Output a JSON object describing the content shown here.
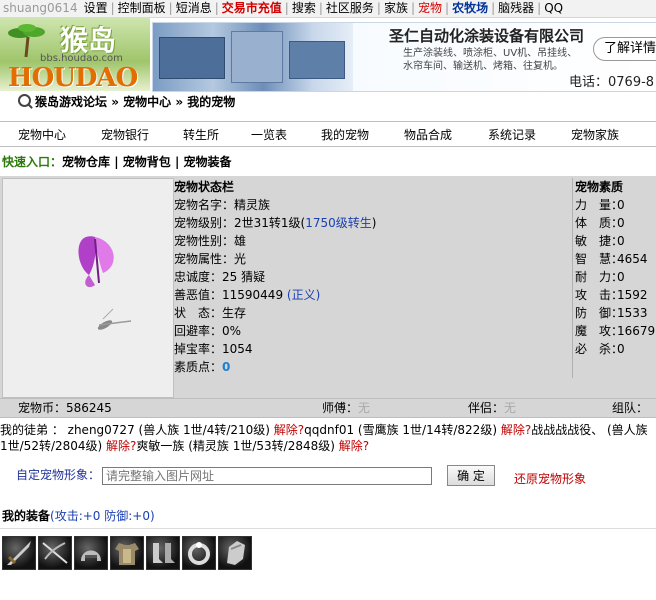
{
  "topnav": {
    "user": "shuang0614",
    "items": [
      "设置",
      "控制面板",
      "短消息",
      "交易市充值",
      "搜索",
      "社区服务",
      "家族",
      "宠物",
      "农牧场",
      "脑残器",
      "QQ"
    ],
    "special": {
      "trade": "交易市充值",
      "pet": "宠物",
      "farm": "农牧场"
    }
  },
  "logo": {
    "text": "HOUDAO",
    "cn": "猴岛",
    "bbs": "bbs.houdao.com"
  },
  "banner": {
    "company": "圣仁自动化涂装设备有限公司",
    "desc": "生产涂装线、喷涂柜、UV机、吊挂线、水帘车间、输送机、烤箱、往复机。",
    "phone": "电话：0769-8",
    "button": "了解详情"
  },
  "breadcrumb": [
    "猴岛游戏论坛",
    "宠物中心",
    "我的宠物"
  ],
  "tabs": [
    "宠物中心",
    "宠物银行",
    "转生所",
    "一览表",
    "我的宠物",
    "物品合成",
    "系统记录",
    "宠物家族"
  ],
  "quick": {
    "label": "快速入口：",
    "links": [
      "宠物仓库",
      "宠物背包",
      "宠物装备"
    ]
  },
  "pet": {
    "title": "宠物状态栏",
    "name": "宠物名字：精灵族",
    "level_prefix": "宠物级别：2世31转1级(",
    "level_link": "1750级转生",
    "level_suffix": ")",
    "gender": "宠物性别：雄",
    "attribute": "宠物属性：光",
    "loyalty": "忠诚度：25 猜疑",
    "karma_prefix": "善恶值：11590449 ",
    "karma_link": "(正义)",
    "status": "状　态：生存",
    "dodge": "回避率：0%",
    "drop": "掉宝率：1054",
    "points_label": "素质点：",
    "points": "0"
  },
  "attrs": {
    "title": "宠物素质",
    "rows": [
      {
        "k": "力　量：",
        "v": "0"
      },
      {
        "k": "体　质：",
        "v": "0"
      },
      {
        "k": "敏　捷：",
        "v": "0"
      },
      {
        "k": "智　慧：",
        "v": "4654"
      },
      {
        "k": "耐　力：",
        "v": "0"
      },
      {
        "k": "攻　击：",
        "v": "1592"
      },
      {
        "k": "防　御：",
        "v": "1533"
      },
      {
        "k": "魔　攻：",
        "v": "16679"
      },
      {
        "k": "必　杀：",
        "v": "0"
      }
    ]
  },
  "bar": {
    "coins": "宠物币：586245",
    "master_label": "师傅：",
    "master": "无",
    "partner_label": "伴侣：",
    "partner": "无",
    "group_label": "组队："
  },
  "disciples": {
    "label": "我的徒弟 ：",
    "list": [
      {
        "text": "zheng0727 (兽人族 1世/4转/210级) ",
        "action": "解除?"
      },
      {
        "text": "qqdnf01 (雪鹰族 1世/14转/822级) ",
        "action": "解除?"
      },
      {
        "text": "战战战战役、 (兽人族 1世/52转/2804级) ",
        "action": "解除?"
      },
      {
        "text": "爽敏一族 (精灵族 1世/53转/2848级) ",
        "action": "解除?"
      }
    ]
  },
  "custom": {
    "label": "自定宠物形象：",
    "placeholder": "请完整输入图片网址",
    "button": "确 定",
    "restore": "还原宠物形象"
  },
  "equip": {
    "title": "我的装备",
    "stats": "(攻击:+0 防御:+0)",
    "items": [
      "sword-icon",
      "crossbow-icon",
      "helmet-icon",
      "armor-icon",
      "boots-icon",
      "ring-icon",
      "gauntlet-icon"
    ]
  }
}
